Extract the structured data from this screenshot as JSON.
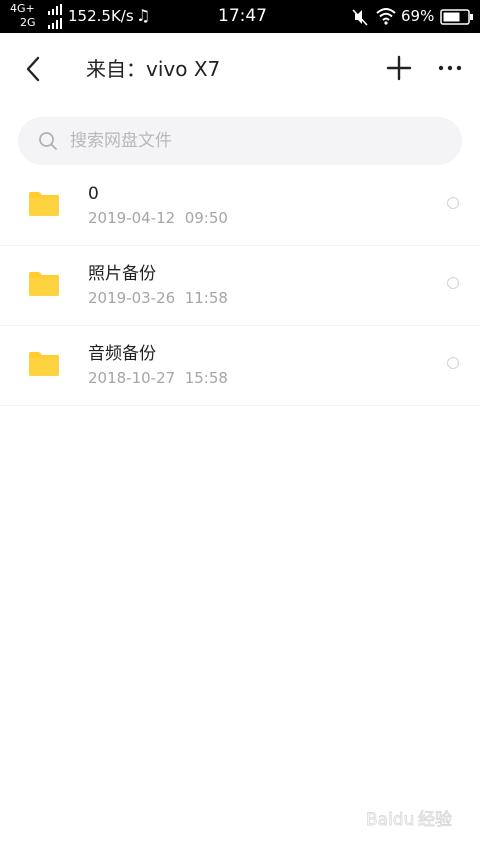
{
  "status_bar": {
    "network_1": "4G+",
    "network_2": "2G",
    "speed": "152.5K/s",
    "music_glyph": "♫",
    "time": "17:47",
    "battery": "69%",
    "icons": [
      "signal-icon",
      "music-icon",
      "mute-icon",
      "wifi-icon",
      "battery-icon"
    ]
  },
  "header": {
    "title": "来自：vivo X7",
    "icons": [
      "back-arrow-icon",
      "plus-icon",
      "more-icon"
    ]
  },
  "search": {
    "placeholder": "搜索网盘文件",
    "icon": "search-icon"
  },
  "files": [
    {
      "name": "0",
      "date": "2019-04-12  09:50",
      "icon": "folder-icon"
    },
    {
      "name": "照片备份",
      "date": "2019-03-26  11:58",
      "icon": "folder-icon"
    },
    {
      "name": "音频备份",
      "date": "2018-10-27  15:58",
      "icon": "folder-icon"
    }
  ],
  "colors": {
    "folder": "#FFCC33",
    "status_bar_bg": "#000000",
    "text_primary": "#222222",
    "text_secondary": "#A5A5AA",
    "search_bg": "#F4F4F6"
  },
  "watermark": "Baidu 经验"
}
